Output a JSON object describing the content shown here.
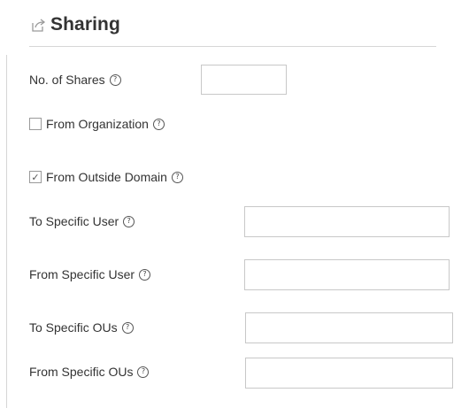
{
  "section": {
    "title": "Sharing",
    "icon": "share-icon"
  },
  "fields": {
    "no_of_shares": {
      "label": "No. of Shares",
      "value": ""
    },
    "from_organization": {
      "label": "From Organization",
      "checked": false
    },
    "from_outside_domain": {
      "label": "From Outside Domain",
      "checked": true
    },
    "to_specific_user": {
      "label": "To Specific User",
      "value": ""
    },
    "from_specific_user": {
      "label": "From Specific User",
      "value": ""
    },
    "to_specific_ous": {
      "label": "To Specific OUs",
      "value": ""
    },
    "from_specific_ous": {
      "label": "From Specific OUs",
      "value": ""
    }
  },
  "help_glyph": "?",
  "check_glyph": "✓"
}
